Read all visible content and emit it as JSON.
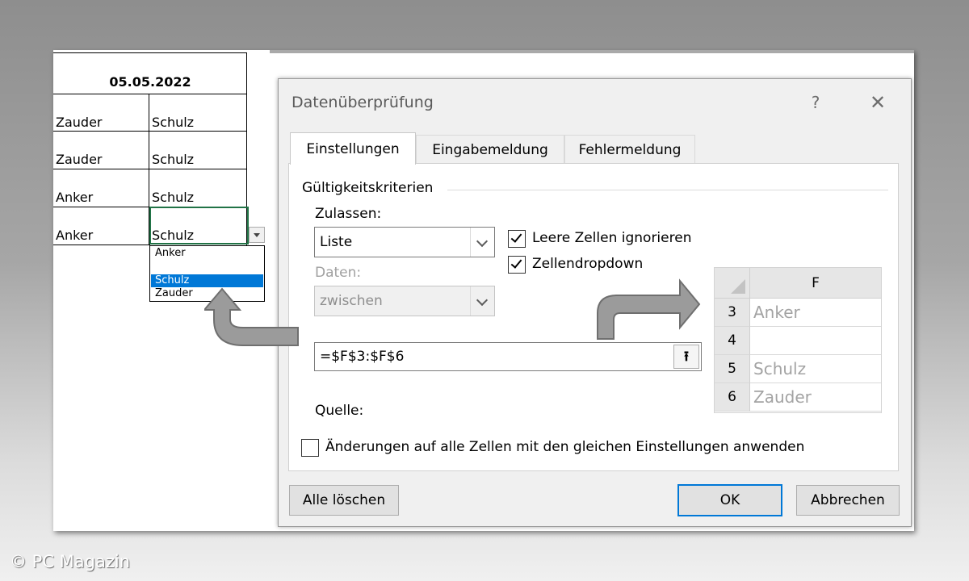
{
  "sheet": {
    "date_header": "05.05.2022",
    "rows": [
      {
        "a": "Zauder",
        "b": "Schulz"
      },
      {
        "a": "Zauder",
        "b": "Schulz"
      },
      {
        "a": "Anker",
        "b": "Schulz"
      },
      {
        "a": "Anker",
        "b": "Schulz"
      }
    ],
    "dropdown": {
      "items": [
        "Anker",
        "",
        "Schulz",
        "Zauder"
      ],
      "selected": "Schulz"
    }
  },
  "dialog": {
    "title": "Datenüberprüfung",
    "help": "?",
    "close": "✕",
    "tabs": [
      "Einstellungen",
      "Eingabemeldung",
      "Fehlermeldung"
    ],
    "active_tab": "Einstellungen",
    "group_label": "Gültigkeitskriterien",
    "allow_label": "Zulassen:",
    "allow_value": "Liste",
    "data_label": "Daten:",
    "data_value": "zwischen",
    "ignore_blank": {
      "label": "Leere Zellen ignorieren",
      "checked": true
    },
    "in_cell_dropdown": {
      "label": "Zellendropdown",
      "checked": true
    },
    "source_label": "Quelle:",
    "source_value": "=$F$3:$F$6",
    "source_btn": "⭱",
    "apply_all": {
      "label": "Änderungen auf alle Zellen mit den gleichen Einstellungen anwenden",
      "checked": false
    },
    "clear_all_label": "Alle löschen",
    "ok_label": "OK",
    "cancel_label": "Abbrechen"
  },
  "mini_sheet": {
    "column": "F",
    "rows": [
      {
        "num": "3",
        "value": "Anker"
      },
      {
        "num": "4",
        "value": ""
      },
      {
        "num": "5",
        "value": "Schulz"
      },
      {
        "num": "6",
        "value": "Zauder"
      }
    ]
  },
  "watermark": "© PC Magazin"
}
